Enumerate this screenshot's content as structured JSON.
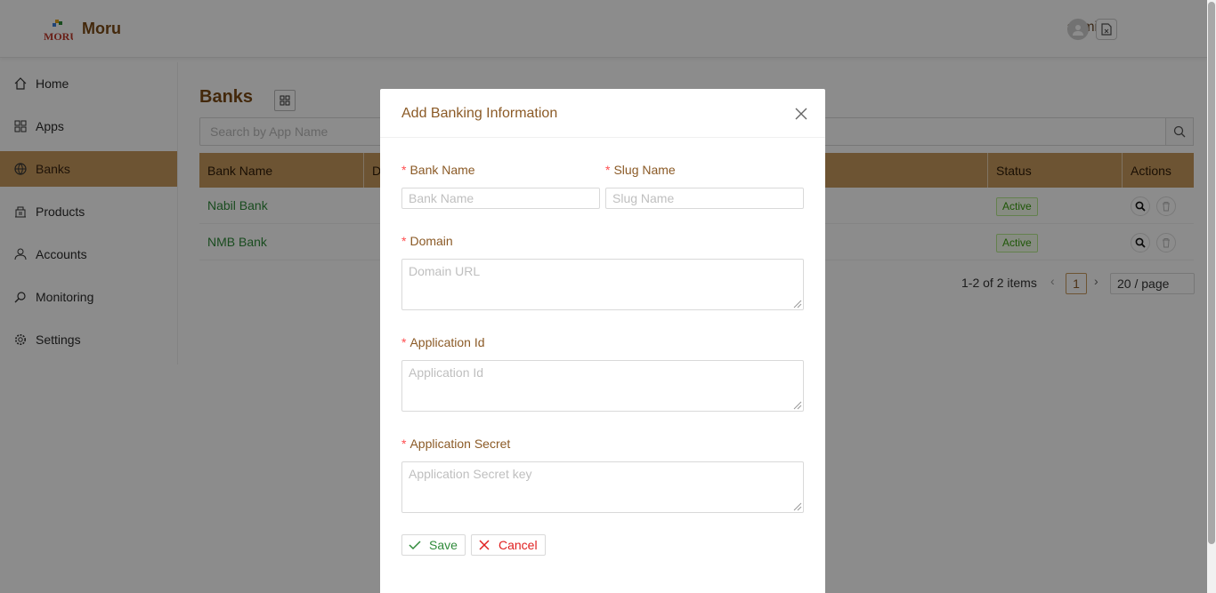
{
  "app": {
    "name": "Moru",
    "logo_text": "MORU"
  },
  "header": {
    "user": "admin"
  },
  "sidebar": {
    "items": [
      {
        "label": "Home",
        "icon": "home-icon"
      },
      {
        "label": "Apps",
        "icon": "apps-grid-icon"
      },
      {
        "label": "Banks",
        "icon": "bank-icon",
        "active": true
      },
      {
        "label": "Products",
        "icon": "products-icon"
      },
      {
        "label": "Accounts",
        "icon": "user-icon"
      },
      {
        "label": "Monitoring",
        "icon": "monitor-icon"
      },
      {
        "label": "Settings",
        "icon": "gear-icon"
      }
    ]
  },
  "main": {
    "title": "Banks",
    "search_placeholder": "Search by App Name",
    "columns": [
      "Bank Name",
      "D",
      "Status",
      "Actions"
    ],
    "rows": [
      {
        "bank_name": "Nabil Bank",
        "status": "Active"
      },
      {
        "bank_name": "NMB Bank",
        "status": "Active"
      }
    ],
    "pagination": {
      "summary": "1-2 of 2 items",
      "current_page": "1",
      "page_size": "20 / page"
    }
  },
  "modal": {
    "title": "Add Banking Information",
    "fields": {
      "bank_name": {
        "label": "Bank Name",
        "placeholder": "Bank Name"
      },
      "slug_name": {
        "label": "Slug Name",
        "placeholder": "Slug Name"
      },
      "domain": {
        "label": "Domain",
        "placeholder": "Domain URL"
      },
      "application_id": {
        "label": "Application Id",
        "placeholder": "Application Id"
      },
      "application_secret": {
        "label": "Application Secret",
        "placeholder": "Application Secret key"
      }
    },
    "save_label": "Save",
    "cancel_label": "Cancel"
  },
  "colors": {
    "accent": "#c69a5e",
    "brand": "#7a4a14",
    "link": "#2f8a3a",
    "danger": "#e02020"
  }
}
